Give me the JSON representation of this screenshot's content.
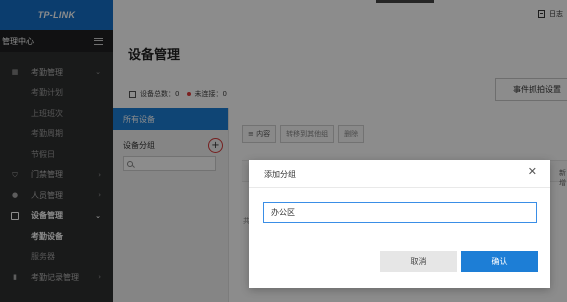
{
  "brand": {
    "logo": "TP-LINK"
  },
  "sidebar": {
    "title": "管理中心",
    "items": [
      {
        "label": "考勤管理",
        "icon": "calendar-icon",
        "level": 1,
        "expanded": true
      },
      {
        "label": "考勤计划",
        "level": 2
      },
      {
        "label": "上班班次",
        "level": 2
      },
      {
        "label": "考勤周期",
        "level": 2
      },
      {
        "label": "节假日",
        "level": 2
      },
      {
        "label": "门禁管理",
        "icon": "shield-icon",
        "level": 1,
        "expanded": false
      },
      {
        "label": "人员管理",
        "icon": "user-icon",
        "level": 1,
        "expanded": false
      },
      {
        "label": "设备管理",
        "icon": "device-icon",
        "level": 1,
        "expanded": true,
        "active": true
      },
      {
        "label": "考勤设备",
        "level": 2,
        "current": true
      },
      {
        "label": "服务器",
        "level": 2
      },
      {
        "label": "考勤记录管理",
        "icon": "chart-icon",
        "level": 1,
        "expanded": false
      }
    ]
  },
  "header": {
    "log_label": "日志"
  },
  "main": {
    "title": "设备管理",
    "stats": {
      "total_label": "设备总数：0",
      "disconnected_label": "未连接：0"
    },
    "event_button": "事件抓拍设置",
    "left_panel": {
      "all_devices": "所有设备",
      "group_label": "设备分组",
      "search_placeholder": ""
    },
    "toolbar": {
      "content_btn": "≡ 内容",
      "move_btn": "转移到其他组",
      "delete_btn": "删除"
    },
    "background_text": {
      "gong": "共",
      "new": "新增"
    }
  },
  "dialog": {
    "title": "添加分组",
    "input_value": "办公区",
    "cancel_label": "取消",
    "confirm_label": "确认"
  },
  "colors": {
    "accent": "#1d7ed6",
    "sidebar_bg": "#2f3031",
    "brand_blue": "#1470c8",
    "alert_red": "#e23b3b"
  }
}
